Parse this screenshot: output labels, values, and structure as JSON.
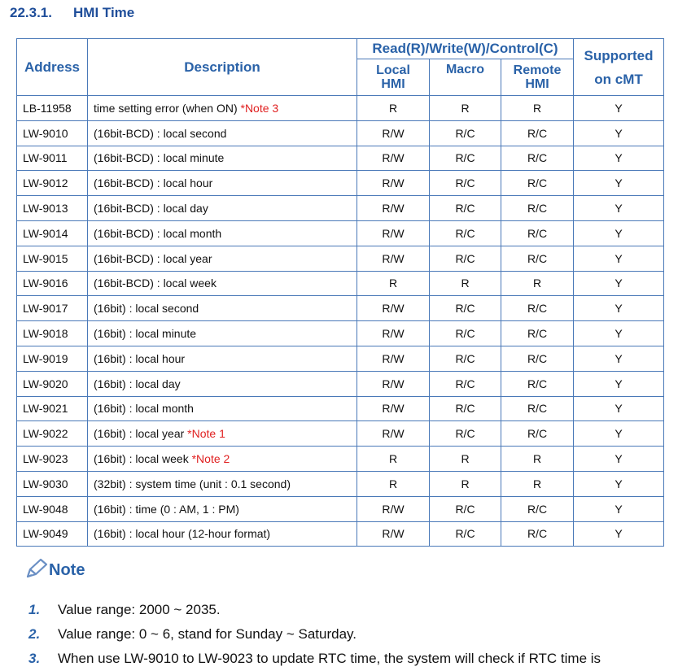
{
  "section": {
    "number": "22.3.1.",
    "title": "HMI Time"
  },
  "table": {
    "headers": {
      "address": "Address",
      "description": "Description",
      "rw_group": "Read(R)/Write(W)/Control(C)",
      "local_hmi": "Local\nHMI",
      "macro": "Macro",
      "remote_hmi": "Remote\nHMI",
      "supported": "Supported\non cMT"
    },
    "rows": [
      {
        "address": "LB-11958",
        "description": "time setting error (when ON) ",
        "note": "*Note 3",
        "local": "R",
        "macro": "R",
        "remote": "R",
        "cmt": "Y"
      },
      {
        "address": "LW-9010",
        "description": "(16bit-BCD) : local second",
        "note": "",
        "local": "R/W",
        "macro": "R/C",
        "remote": "R/C",
        "cmt": "Y"
      },
      {
        "address": "LW-9011",
        "description": "(16bit-BCD) : local minute",
        "note": "",
        "local": "R/W",
        "macro": "R/C",
        "remote": "R/C",
        "cmt": "Y"
      },
      {
        "address": "LW-9012",
        "description": "(16bit-BCD) : local hour",
        "note": "",
        "local": "R/W",
        "macro": "R/C",
        "remote": "R/C",
        "cmt": "Y"
      },
      {
        "address": "LW-9013",
        "description": "(16bit-BCD) : local day",
        "note": "",
        "local": "R/W",
        "macro": "R/C",
        "remote": "R/C",
        "cmt": "Y"
      },
      {
        "address": "LW-9014",
        "description": "(16bit-BCD) : local month",
        "note": "",
        "local": "R/W",
        "macro": "R/C",
        "remote": "R/C",
        "cmt": "Y"
      },
      {
        "address": "LW-9015",
        "description": "(16bit-BCD) : local year",
        "note": "",
        "local": "R/W",
        "macro": "R/C",
        "remote": "R/C",
        "cmt": "Y"
      },
      {
        "address": "LW-9016",
        "description": "(16bit-BCD) : local week",
        "note": "",
        "local": "R",
        "macro": "R",
        "remote": "R",
        "cmt": "Y"
      },
      {
        "address": "LW-9017",
        "description": "(16bit) : local second",
        "note": "",
        "local": "R/W",
        "macro": "R/C",
        "remote": "R/C",
        "cmt": "Y"
      },
      {
        "address": "LW-9018",
        "description": "(16bit) : local minute",
        "note": "",
        "local": "R/W",
        "macro": "R/C",
        "remote": "R/C",
        "cmt": "Y"
      },
      {
        "address": "LW-9019",
        "description": "(16bit) : local hour",
        "note": "",
        "local": "R/W",
        "macro": "R/C",
        "remote": "R/C",
        "cmt": "Y"
      },
      {
        "address": "LW-9020",
        "description": "(16bit) : local day",
        "note": "",
        "local": "R/W",
        "macro": "R/C",
        "remote": "R/C",
        "cmt": "Y"
      },
      {
        "address": "LW-9021",
        "description": "(16bit) : local month",
        "note": "",
        "local": "R/W",
        "macro": "R/C",
        "remote": "R/C",
        "cmt": "Y"
      },
      {
        "address": "LW-9022",
        "description": "(16bit) : local year ",
        "note": "*Note 1",
        "local": "R/W",
        "macro": "R/C",
        "remote": "R/C",
        "cmt": "Y"
      },
      {
        "address": "LW-9023",
        "description": "(16bit) : local week ",
        "note": "*Note 2",
        "local": "R",
        "macro": "R",
        "remote": "R",
        "cmt": "Y"
      },
      {
        "address": "LW-9030",
        "description": "(32bit) : system time (unit : 0.1 second)",
        "note": "",
        "local": "R",
        "macro": "R",
        "remote": "R",
        "cmt": "Y"
      },
      {
        "address": "LW-9048",
        "description": "(16bit) : time (0 : AM, 1 : PM)",
        "note": "",
        "local": "R/W",
        "macro": "R/C",
        "remote": "R/C",
        "cmt": "Y"
      },
      {
        "address": "LW-9049",
        "description": "(16bit) : local hour (12-hour format)",
        "note": "",
        "local": "R/W",
        "macro": "R/C",
        "remote": "R/C",
        "cmt": "Y"
      }
    ]
  },
  "notes": {
    "heading": "Note",
    "icon": "pencil-icon",
    "items": [
      {
        "num": "1.",
        "text": "Value range: 2000 ~ 2035."
      },
      {
        "num": "2.",
        "text": "Value range: 0 ~ 6, stand for Sunday ~ Saturday."
      },
      {
        "num": "3.",
        "text": "When use LW-9010 to LW-9023 to update RTC time, the system will check if RTC time is"
      }
    ]
  },
  "colors": {
    "heading_blue": "#2a62a8",
    "border_blue": "#4a79b8",
    "note_red": "#e02020"
  }
}
